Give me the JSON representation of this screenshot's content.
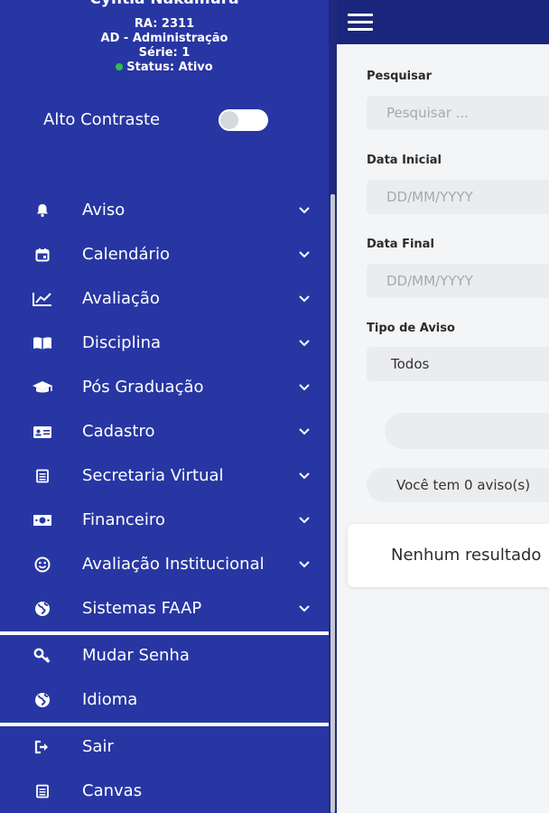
{
  "profile": {
    "name": "Cyntia Nakamura",
    "ra": "RA: 2311",
    "course": "AD - Administração",
    "serie": "Série: 1",
    "status": "Status: Ativo"
  },
  "contrast": {
    "label": "Alto Contraste",
    "enabled": false
  },
  "menu": [
    {
      "label": "Aviso",
      "icon": "bell-icon"
    },
    {
      "label": "Calendário",
      "icon": "calendar-icon"
    },
    {
      "label": "Avaliação",
      "icon": "chart-line-icon"
    },
    {
      "label": "Disciplina",
      "icon": "book-open-icon"
    },
    {
      "label": "Pós Graduação",
      "icon": "graduation-cap-icon"
    },
    {
      "label": "Cadastro",
      "icon": "id-card-icon"
    },
    {
      "label": "Secretaria Virtual",
      "icon": "document-icon"
    },
    {
      "label": "Financeiro",
      "icon": "money-bill-icon"
    },
    {
      "label": "Avaliação Institucional",
      "icon": "smiley-icon"
    },
    {
      "label": "Sistemas FAAP",
      "icon": "globe-icon"
    }
  ],
  "account_menu": [
    {
      "label": "Mudar Senha",
      "icon": "key-icon"
    },
    {
      "label": "Idioma",
      "icon": "globe-icon"
    }
  ],
  "footer_menu": [
    {
      "label": "Sair",
      "icon": "sign-out-icon"
    },
    {
      "label": "Canvas",
      "icon": "document-icon"
    }
  ],
  "filters": {
    "search": {
      "label": "Pesquisar",
      "placeholder": "Pesquisar ...",
      "value": ""
    },
    "start_date": {
      "label": "Data Inicial",
      "placeholder": "DD/MM/YYYY",
      "value": ""
    },
    "end_date": {
      "label": "Data Final",
      "placeholder": "DD/MM/YYYY",
      "value": ""
    },
    "type": {
      "label": "Tipo de Aviso",
      "value": "Todos"
    }
  },
  "results": {
    "count_text": "Você tem 0 aviso(s)",
    "empty_text": "Nenhum resultado"
  },
  "colors": {
    "sidebar": "#2736a3",
    "topbar": "#1a267b",
    "status_active": "#2ec04a"
  }
}
